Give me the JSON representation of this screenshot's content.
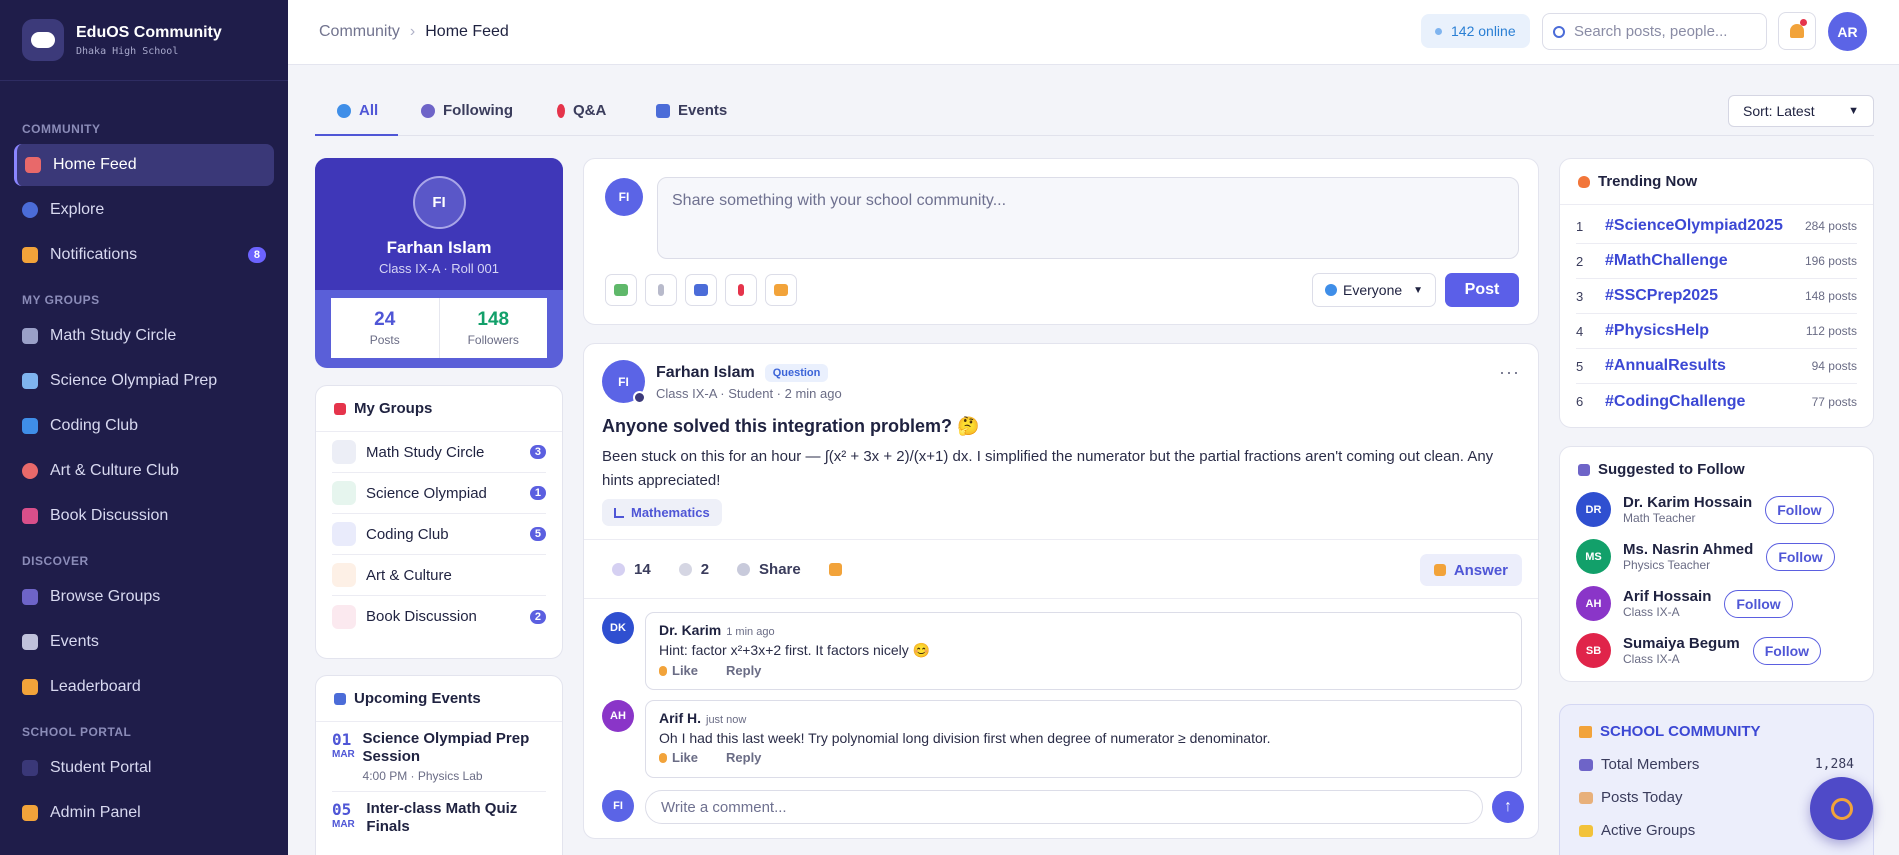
{
  "brand": {
    "name": "EduOS Community",
    "school": "Dhaka High School"
  },
  "sidebar": {
    "sections": [
      {
        "title": "Community",
        "items": [
          {
            "label": "Home Feed",
            "icon": "home-icon",
            "active": true
          },
          {
            "label": "Explore",
            "icon": "search-icon"
          },
          {
            "label": "Notifications",
            "icon": "bell-icon",
            "badge": "8"
          }
        ]
      },
      {
        "title": "My Groups",
        "items": [
          {
            "label": "Math Study Circle",
            "icon": "ruler-icon"
          },
          {
            "label": "Science Olympiad Prep",
            "icon": "microscope-icon"
          },
          {
            "label": "Coding Club",
            "icon": "laptop-icon"
          },
          {
            "label": "Art & Culture Club",
            "icon": "palette-icon"
          },
          {
            "label": "Book Discussion",
            "icon": "books-icon"
          }
        ]
      },
      {
        "title": "Discover",
        "items": [
          {
            "label": "Browse Groups",
            "icon": "people-icon"
          },
          {
            "label": "Events",
            "icon": "pin-icon"
          },
          {
            "label": "Leaderboard",
            "icon": "trophy-icon"
          }
        ]
      },
      {
        "title": "School Portal",
        "items": [
          {
            "label": "Student Portal",
            "icon": "cap-icon"
          },
          {
            "label": "Admin Panel",
            "icon": "key-icon"
          }
        ]
      }
    ]
  },
  "header": {
    "breadcrumb_root": "Community",
    "breadcrumb_sep": "›",
    "breadcrumb_current": "Home Feed",
    "online": "142 online",
    "search_placeholder": "Search posts, people...",
    "avatar": "AR"
  },
  "tabs": [
    {
      "label": "All",
      "active": true
    },
    {
      "label": "Following"
    },
    {
      "label": "Q&A"
    },
    {
      "label": "Events"
    }
  ],
  "sort": {
    "value": "Sort: Latest"
  },
  "profile": {
    "initials": "FI",
    "name": "Farhan Islam",
    "class": "Class IX-A · Roll 001",
    "posts": "24",
    "posts_label": "Posts",
    "followers": "148",
    "followers_label": "Followers"
  },
  "groups": {
    "title": "My Groups",
    "items": [
      {
        "label": "Math Study Circle",
        "badge": "3"
      },
      {
        "label": "Science Olympiad",
        "badge": "1"
      },
      {
        "label": "Coding Club",
        "badge": "5"
      },
      {
        "label": "Art & Culture",
        "badge": ""
      },
      {
        "label": "Book Discussion",
        "badge": "2"
      }
    ]
  },
  "events": {
    "title": "Upcoming Events",
    "items": [
      {
        "day": "01",
        "month": "MAR",
        "title": "Science Olympiad Prep Session",
        "sub": "4:00 PM · Physics Lab"
      },
      {
        "day": "05",
        "month": "MAR",
        "title": "Inter-class Math Quiz Finals",
        "sub": ""
      }
    ]
  },
  "composer": {
    "initials": "FI",
    "placeholder": "Share something with your school community...",
    "audience": "Everyone",
    "post_label": "Post"
  },
  "post": {
    "initials": "FI",
    "author": "Farhan Islam",
    "tag": "Question",
    "meta": "Class IX-A · Student · 2 min ago",
    "more": "···",
    "title": "Anyone solved this integration problem? 🤔",
    "body": "Been stuck on this for an hour — ∫(x² + 3x + 2)/(x+1) dx. I simplified the numerator but the partial fractions aren't coming out clean. Any hints appreciated!",
    "topic": "Mathematics",
    "likes": "14",
    "comments": "2",
    "share": "Share",
    "answer": "Answer"
  },
  "comments": [
    {
      "initials": "DK",
      "author": "Dr. Karim",
      "time": "1 min ago",
      "text": "Hint: factor x²+3x+2 first. It factors nicely 😊",
      "like": "Like",
      "reply": "Reply",
      "color": "#2f4fd0"
    },
    {
      "initials": "AH",
      "author": "Arif H.",
      "time": "just now",
      "text": "Oh I had this last week! Try polynomial long division first when degree of numerator ≥ denominator.",
      "like": "Like",
      "reply": "Reply",
      "color": "#8a35c8"
    }
  ],
  "comment_input": {
    "initials": "FI",
    "placeholder": "Write a comment...",
    "send": "↑"
  },
  "trending": {
    "title": "Trending Now",
    "items": [
      {
        "rank": "1",
        "tag": "#ScienceOlympiad2025",
        "count": "284 posts"
      },
      {
        "rank": "2",
        "tag": "#MathChallenge",
        "count": "196 posts"
      },
      {
        "rank": "3",
        "tag": "#SSCPrep2025",
        "count": "148 posts"
      },
      {
        "rank": "4",
        "tag": "#PhysicsHelp",
        "count": "112 posts"
      },
      {
        "rank": "5",
        "tag": "#AnnualResults",
        "count": "94 posts"
      },
      {
        "rank": "6",
        "tag": "#CodingChallenge",
        "count": "77 posts"
      }
    ]
  },
  "suggested": {
    "title": "Suggested to Follow",
    "follow_label": "Follow",
    "items": [
      {
        "initials": "DR",
        "name": "Dr. Karim Hossain",
        "role": "Math Teacher",
        "color": "#2f4fd0"
      },
      {
        "initials": "MS",
        "name": "Ms. Nasrin Ahmed",
        "role": "Physics Teacher",
        "color": "#12a06a"
      },
      {
        "initials": "AH",
        "name": "Arif Hossain",
        "role": "Class IX-A",
        "color": "#8a35c8"
      },
      {
        "initials": "SB",
        "name": "Sumaiya Begum",
        "role": "Class IX-A",
        "color": "#e0244a"
      }
    ]
  },
  "school": {
    "title": "SCHOOL COMMUNITY",
    "rows": [
      {
        "label": "Total Members",
        "value": "1,284"
      },
      {
        "label": "Posts Today",
        "value": ""
      },
      {
        "label": "Active Groups",
        "value": ""
      }
    ]
  }
}
